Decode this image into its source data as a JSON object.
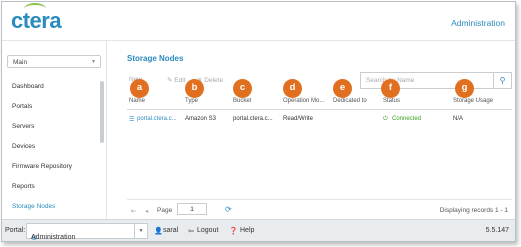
{
  "header": {
    "logo": "ctera",
    "title": "Administration"
  },
  "sidebar": {
    "select_value": "Main",
    "items": [
      {
        "label": "Dashboard"
      },
      {
        "label": "Portals"
      },
      {
        "label": "Servers"
      },
      {
        "label": "Devices"
      },
      {
        "label": "Firmware Repository"
      },
      {
        "label": "Reports"
      },
      {
        "label": "Storage Nodes",
        "active": true
      }
    ]
  },
  "main": {
    "title": "Storage Nodes",
    "toolbar": {
      "new": "New",
      "edit": "Edit",
      "delete": "Delete"
    },
    "search_placeholder": "Search by Name",
    "columns": [
      "Name",
      "Type",
      "Bucket",
      "Operation Mo...",
      "Dedicated to",
      "Status",
      "Storage Usage"
    ],
    "rows": [
      {
        "name": "portal.ctera.c...",
        "type": "Amazon S3",
        "bucket": "portal.ctera.c...",
        "operation_mode": "Read/Write",
        "dedicated_to": "",
        "status": "Connected",
        "storage_usage": "N/A"
      }
    ],
    "badges": [
      "a",
      "b",
      "c",
      "d",
      "e",
      "f",
      "g"
    ],
    "pager": {
      "page_label": "Page",
      "page_number": "1",
      "displaying": "Displaying records 1 - 1"
    }
  },
  "footer": {
    "portal_label": "Portal:",
    "portal_value": "Administration",
    "user": "saral",
    "logout": "Logout",
    "help": "Help",
    "version": "5.5.147"
  },
  "colors": {
    "accent": "#2a8bbf",
    "badge": "#e0701f",
    "status_ok": "#3a9d23",
    "logo_arc": "#8bc34a"
  }
}
